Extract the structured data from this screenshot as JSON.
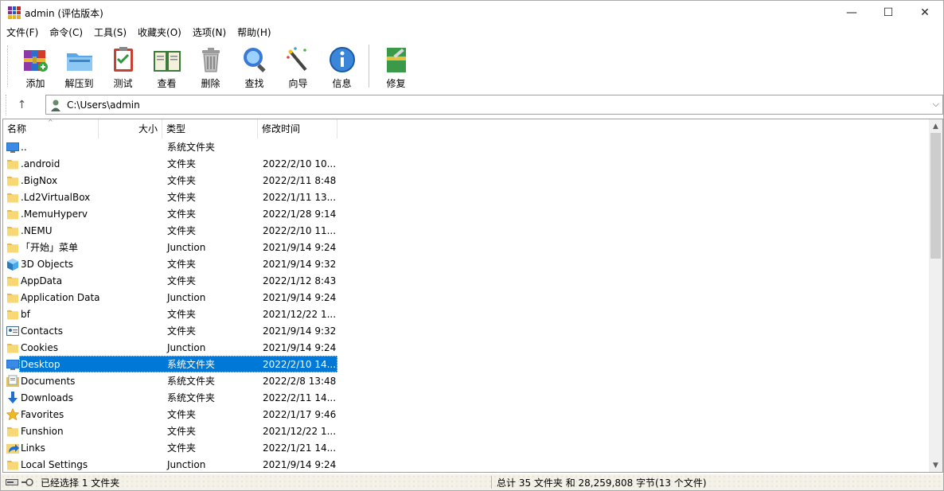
{
  "window": {
    "title": "admin (评估版本)",
    "minimize_glyph": "—",
    "maximize_glyph": "☐",
    "close_glyph": "✕"
  },
  "menu": [
    "文件(F)",
    "命令(C)",
    "工具(S)",
    "收藏夹(O)",
    "选项(N)",
    "帮助(H)"
  ],
  "toolbar": {
    "tools": [
      {
        "label": "添加",
        "icon": "add-archive-icon"
      },
      {
        "label": "解压到",
        "icon": "extract-to-icon"
      },
      {
        "label": "测试",
        "icon": "test-icon"
      },
      {
        "label": "查看",
        "icon": "view-icon"
      },
      {
        "label": "删除",
        "icon": "delete-icon"
      },
      {
        "label": "查找",
        "icon": "find-icon"
      },
      {
        "label": "向导",
        "icon": "wizard-icon"
      },
      {
        "label": "信息",
        "icon": "info-icon"
      },
      {
        "label": "修复",
        "icon": "repair-icon"
      }
    ]
  },
  "address": {
    "up_glyph": "↑",
    "path": "C:\\Users\\admin",
    "dropdown_glyph": "⌵"
  },
  "columns": {
    "name": "名称",
    "size": "大小",
    "type": "类型",
    "modified": "修改时间",
    "sort_glyph": "^"
  },
  "files": [
    {
      "name": "..",
      "type": "系统文件夹",
      "modified": "",
      "icon": "parent-folder-icon"
    },
    {
      "name": ".android",
      "type": "文件夹",
      "modified": "2022/2/10 10...",
      "icon": "folder-icon"
    },
    {
      "name": ".BigNox",
      "type": "文件夹",
      "modified": "2022/2/11 8:48",
      "icon": "folder-icon"
    },
    {
      "name": ".Ld2VirtualBox",
      "type": "文件夹",
      "modified": "2022/1/11 13...",
      "icon": "folder-icon"
    },
    {
      "name": ".MemuHyperv",
      "type": "文件夹",
      "modified": "2022/1/28 9:14",
      "icon": "folder-icon"
    },
    {
      "name": ".NEMU",
      "type": "文件夹",
      "modified": "2022/2/10 11...",
      "icon": "folder-icon"
    },
    {
      "name": "「开始」菜单",
      "type": "Junction",
      "modified": "2021/9/14 9:24",
      "icon": "folder-icon"
    },
    {
      "name": "3D Objects",
      "type": "文件夹",
      "modified": "2021/9/14 9:32",
      "icon": "3d-objects-icon"
    },
    {
      "name": "AppData",
      "type": "文件夹",
      "modified": "2022/1/12 8:43",
      "icon": "folder-icon"
    },
    {
      "name": "Application Data",
      "type": "Junction",
      "modified": "2021/9/14 9:24",
      "icon": "folder-icon"
    },
    {
      "name": "bf",
      "type": "文件夹",
      "modified": "2021/12/22 1...",
      "icon": "folder-icon"
    },
    {
      "name": "Contacts",
      "type": "文件夹",
      "modified": "2021/9/14 9:32",
      "icon": "contacts-icon"
    },
    {
      "name": "Cookies",
      "type": "Junction",
      "modified": "2021/9/14 9:24",
      "icon": "folder-icon"
    },
    {
      "name": "Desktop",
      "type": "系统文件夹",
      "modified": "2022/2/10 14...",
      "icon": "desktop-icon",
      "selected": true
    },
    {
      "name": "Documents",
      "type": "系统文件夹",
      "modified": "2022/2/8 13:48",
      "icon": "documents-icon"
    },
    {
      "name": "Downloads",
      "type": "系统文件夹",
      "modified": "2022/2/11 14...",
      "icon": "downloads-icon"
    },
    {
      "name": "Favorites",
      "type": "文件夹",
      "modified": "2022/1/17 9:46",
      "icon": "favorites-icon"
    },
    {
      "name": "Funshion",
      "type": "文件夹",
      "modified": "2021/12/22 1...",
      "icon": "folder-icon"
    },
    {
      "name": "Links",
      "type": "文件夹",
      "modified": "2022/1/21 14...",
      "icon": "links-icon"
    },
    {
      "name": "Local Settings",
      "type": "Junction",
      "modified": "2021/9/14 9:24",
      "icon": "folder-icon"
    }
  ],
  "scrollbar": {
    "up_glyph": "▲",
    "down_glyph": "▼"
  },
  "status": {
    "left": "已经选择 1 文件夹",
    "right": "总计 35 文件夹 和 28,259,808 字节(13 个文件)"
  }
}
